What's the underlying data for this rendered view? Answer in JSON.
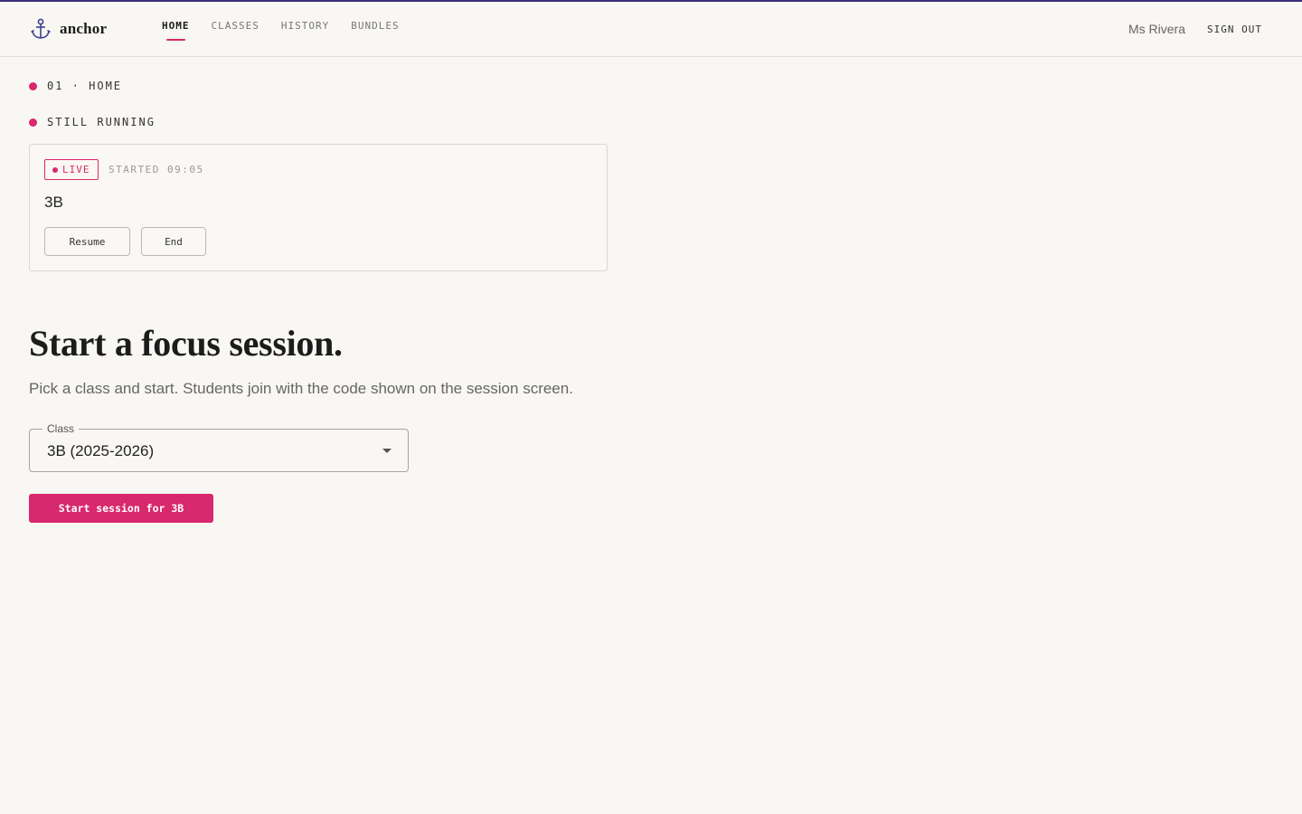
{
  "app": {
    "name": "anchor",
    "logo_icon": "anchor-icon"
  },
  "nav": {
    "items": [
      {
        "label": "HOME",
        "active": true
      },
      {
        "label": "CLASSES",
        "active": false
      },
      {
        "label": "HISTORY",
        "active": false
      },
      {
        "label": "BUNDLES",
        "active": false
      }
    ]
  },
  "user": {
    "name": "Ms Rivera",
    "sign_out_label": "SIGN OUT"
  },
  "breadcrumb": "01 · HOME",
  "running_section": {
    "heading": "STILL RUNNING",
    "session": {
      "status_label": "LIVE",
      "started": "STARTED 09:05",
      "class_name": "3B",
      "resume_label": "Resume",
      "end_label": "End"
    }
  },
  "start_section": {
    "title": "Start a focus session.",
    "subtitle": "Pick a class and start. Students join with the code shown on the session screen.",
    "class_select": {
      "legend": "Class",
      "value": "3B (2025-2026)"
    },
    "start_button_label": "Start session for 3B"
  },
  "colors": {
    "accent": "#d8286e",
    "topline": "#3b2f7a",
    "background": "#f9f7f3"
  }
}
